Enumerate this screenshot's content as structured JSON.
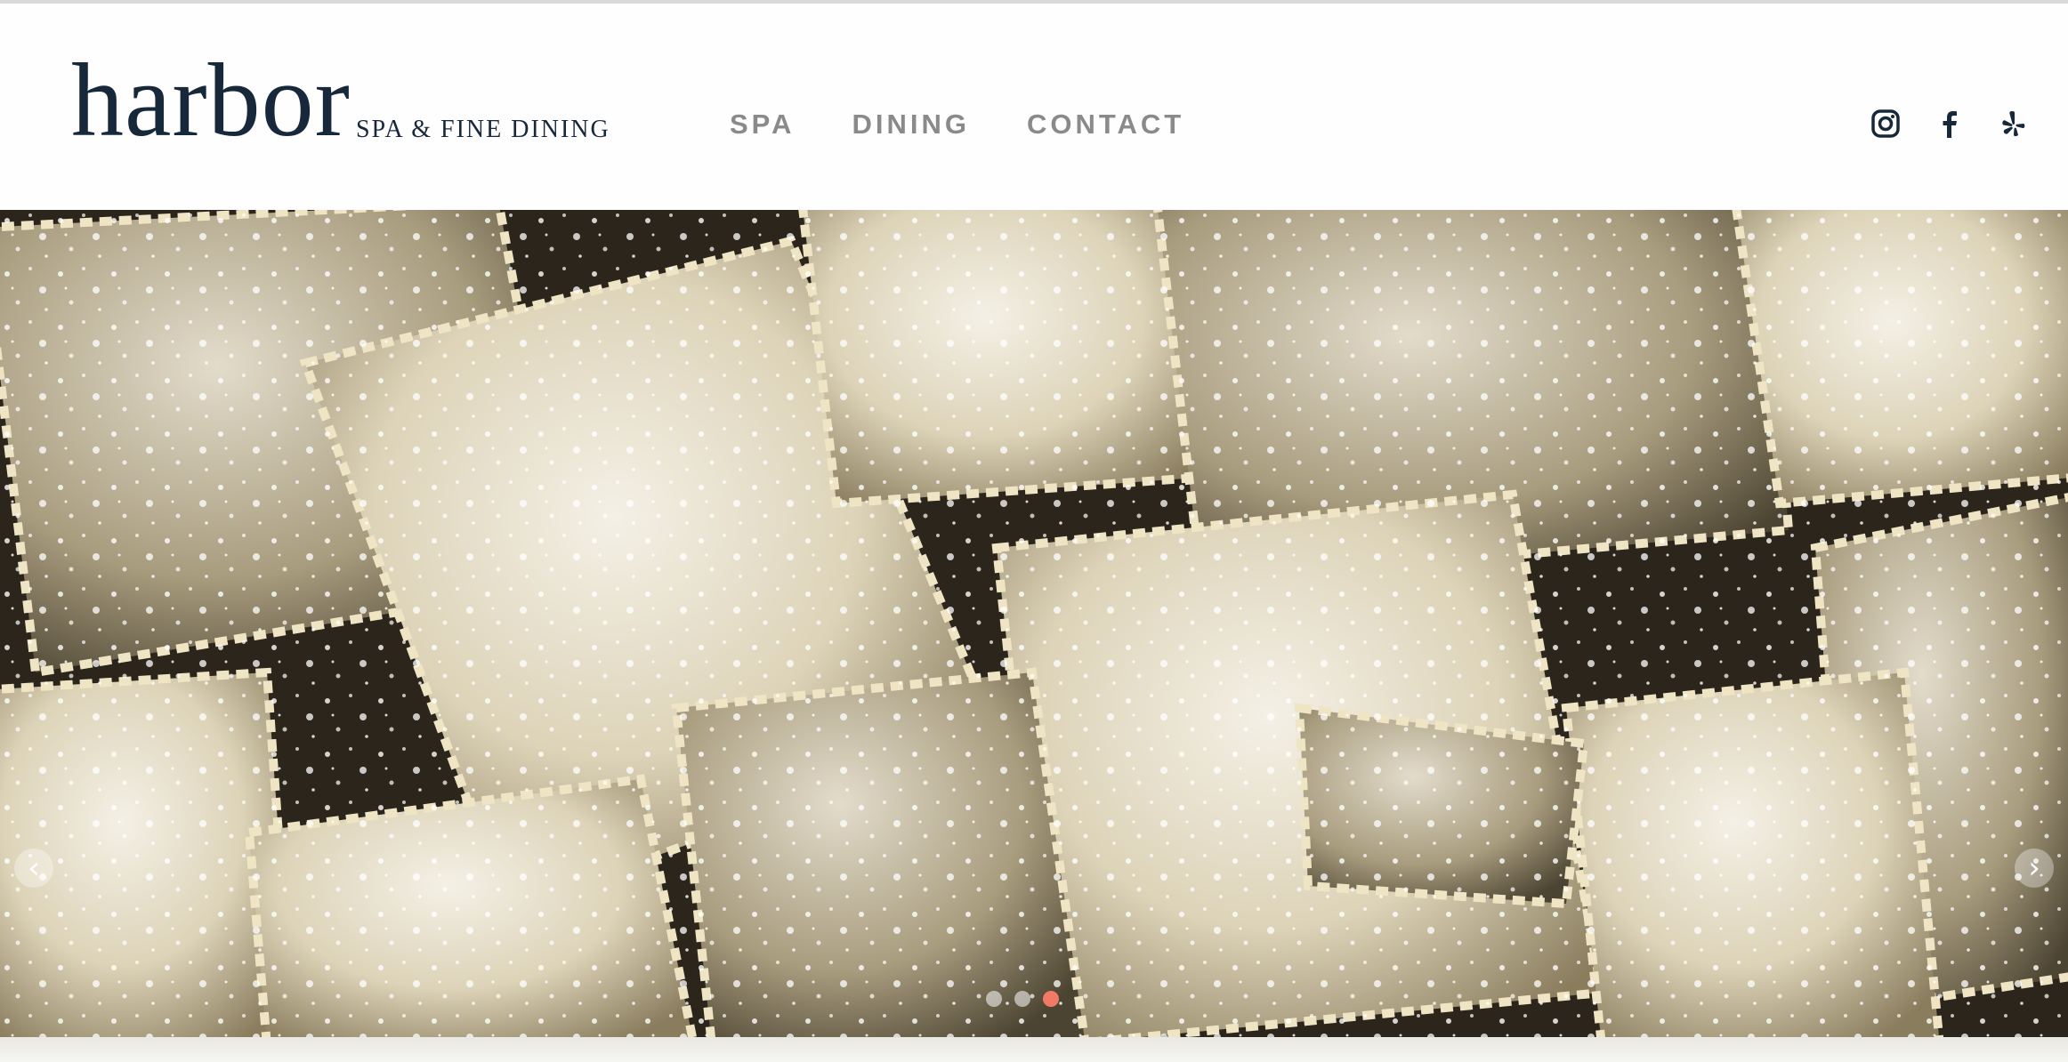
{
  "brand": {
    "name": "harbor",
    "tagline": "SPA & FINE DINING"
  },
  "nav": {
    "items": [
      {
        "label": "SPA"
      },
      {
        "label": "DINING"
      },
      {
        "label": "CONTACT"
      }
    ]
  },
  "social": {
    "icons": [
      "instagram-icon",
      "facebook-icon",
      "yelp-icon"
    ],
    "color": "#17283b"
  },
  "hero": {
    "subject": "ravioli-photo",
    "prev_arrow": "‹",
    "next_arrow": "›",
    "slides_total": 3,
    "active_slide": 3,
    "active_dot_color": "#f07a66"
  }
}
